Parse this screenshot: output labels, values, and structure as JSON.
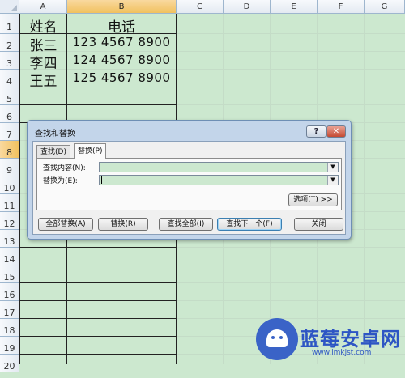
{
  "sheet": {
    "columns": [
      "A",
      "B",
      "C",
      "D",
      "E",
      "F",
      "G"
    ],
    "rows": [
      "1",
      "2",
      "3",
      "4",
      "5",
      "6",
      "7",
      "8",
      "9",
      "10",
      "11",
      "12",
      "13",
      "14",
      "15",
      "16",
      "17",
      "18",
      "19",
      "20"
    ],
    "selected_column": "B",
    "selected_row": "8",
    "cells": {
      "A1": "姓名",
      "B1": "电话",
      "A2": "张三",
      "B2": "123  4567  8900",
      "A3": "李四",
      "B3": "124  4567  8900",
      "A4": "王五",
      "B4": "125  4567  8900"
    }
  },
  "dialog": {
    "title": "查找和替换",
    "help_label": "?",
    "close_label": "✕",
    "tabs": [
      {
        "label": "查找(D)",
        "active": false
      },
      {
        "label": "替换(P)",
        "active": true
      }
    ],
    "find_label": "查找内容(N):",
    "find_value": "",
    "replace_label": "替换为(E):",
    "replace_value": "",
    "options_button": "选项(T) >>",
    "buttons": {
      "replace_all": "全部替换(A)",
      "replace": "替换(R)",
      "find_all": "查找全部(I)",
      "find_next": "查找下一个(F)",
      "close": "关闭"
    }
  },
  "watermark": {
    "brand": "蓝莓安卓网",
    "url": "www.lmkjst.com"
  },
  "colors": {
    "sheet_background": "#cce8cf",
    "selected_header": "#f1c15f",
    "dialog_frame": "#c3d5ea",
    "watermark_blue": "#2d55c4"
  }
}
